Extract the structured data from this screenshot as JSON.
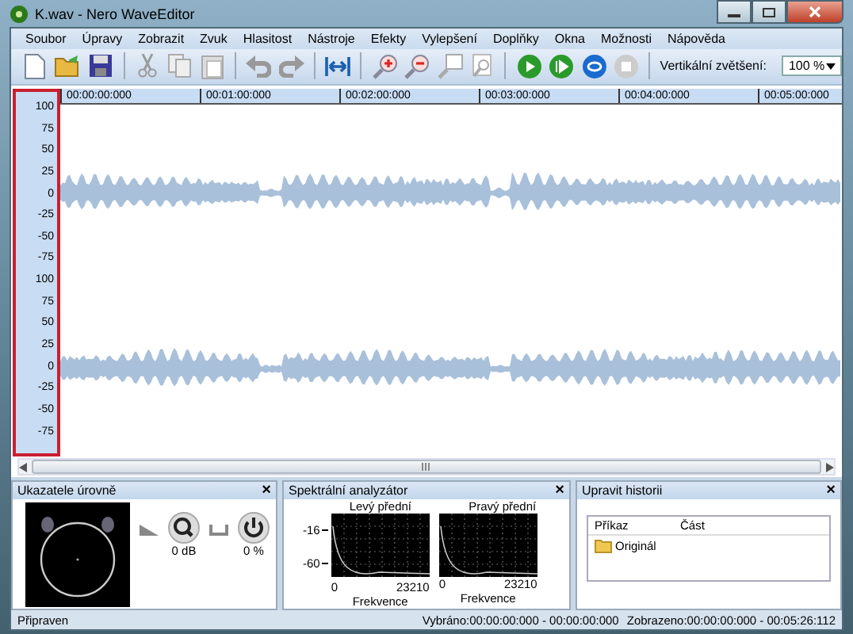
{
  "window": {
    "title": "K.wav - Nero WaveEditor"
  },
  "menu": [
    "Soubor",
    "Úpravy",
    "Zobrazit",
    "Zvuk",
    "Hlasitost",
    "Nástroje",
    "Efekty",
    "Vylepšení",
    "Doplňky",
    "Okna",
    "Možnosti",
    "Nápověda"
  ],
  "toolbar": {
    "zoom_label": "Vertikální zvětšení:",
    "zoom_value": "100 %"
  },
  "ruler": [
    "00:00:00:000",
    "00:01:00:000",
    "00:02:00:000",
    "00:03:00:000",
    "00:04:00:000",
    "00:05:00:000"
  ],
  "channels": [
    {
      "scale": [
        "100",
        "75",
        "50",
        "25",
        "0",
        "-25",
        "-50",
        "-75"
      ]
    },
    {
      "scale": [
        "100",
        "75",
        "50",
        "25",
        "0",
        "-25",
        "-50",
        "-75"
      ]
    }
  ],
  "panels": {
    "level_meters": {
      "title": "Ukazatele úrovně",
      "close": "×",
      "volume": "0 dB",
      "balance": "0 %"
    },
    "spectrum": {
      "title": "Spektrální analyzátor",
      "close": "×",
      "channels": [
        {
          "label": "Levý přední",
          "y_ticks": [
            "-16",
            "-60"
          ],
          "x_ticks": [
            "0",
            "23210"
          ],
          "xlabel": "Frekvence"
        },
        {
          "label": "Pravý přední",
          "x_ticks": [
            "0",
            "23210"
          ],
          "xlabel": "Frekvence"
        }
      ]
    },
    "history": {
      "title": "Upravit historii",
      "close": "×",
      "columns": [
        "Příkaz",
        "Část"
      ],
      "rows": [
        {
          "command": "Originál"
        }
      ]
    }
  },
  "status_bar": {
    "state": "Připraven",
    "selected": "Vybráno:00:00:00:000 - 00:00:00:000",
    "displayed": "Zobrazeno:00:00:00:000 - 00:05:26:112"
  }
}
